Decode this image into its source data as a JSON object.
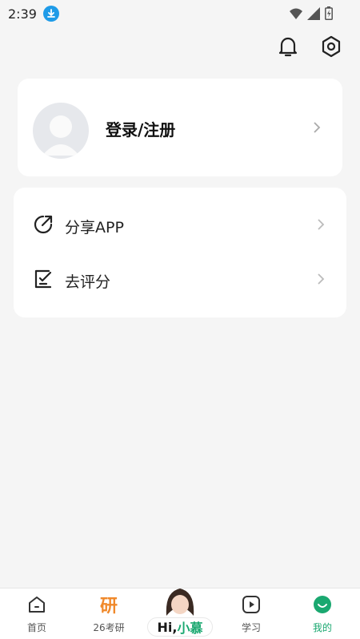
{
  "status_bar": {
    "time": "2:39"
  },
  "profile": {
    "login_label": "登录/注册"
  },
  "menu": {
    "items": [
      {
        "label": "分享APP",
        "icon": "share-icon"
      },
      {
        "label": "去评分",
        "icon": "rate-icon"
      }
    ]
  },
  "tabbar": {
    "items": [
      {
        "label": "首页",
        "icon": "home-icon"
      },
      {
        "label": "26考研",
        "glyph": "研"
      },
      {
        "label": "学习",
        "icon": "play-icon"
      },
      {
        "label": "我的",
        "icon": "smile-icon"
      }
    ],
    "active": "我的",
    "center": {
      "hi": "Hi,",
      "name": "小慕"
    }
  },
  "colors": {
    "accent": "#1aa870",
    "orange": "#f0892b",
    "download_badge": "#1e9be8"
  }
}
